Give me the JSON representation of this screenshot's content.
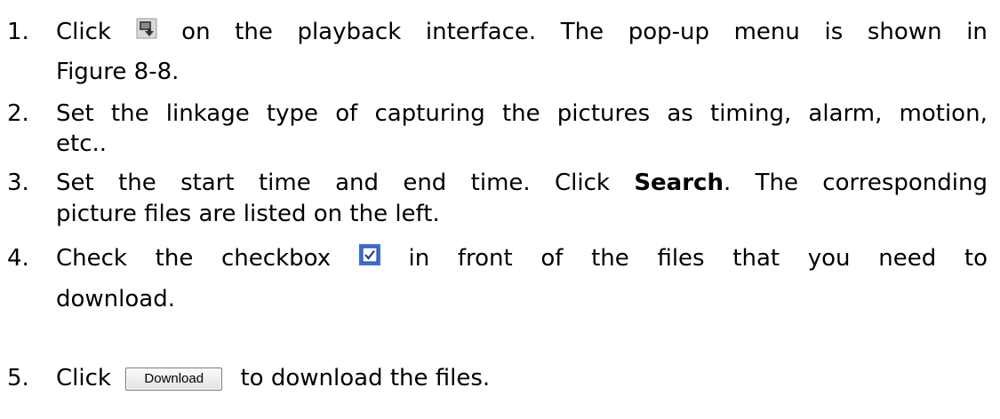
{
  "steps": [
    {
      "number": "1.",
      "before": "Click",
      "icon": "download-picture-icon",
      "after_words": [
        "on",
        "the",
        "playback",
        "interface.",
        "The",
        "pop-up",
        "menu",
        "is",
        "shown",
        "in"
      ],
      "continuation": "Figure 8-8."
    },
    {
      "number": "2.",
      "line1_words": [
        "Set",
        "the",
        "linkage",
        "type",
        "of",
        "capturing",
        "the",
        "pictures",
        "as",
        "timing,",
        "alarm,",
        "motion,"
      ],
      "continuation": "etc.."
    },
    {
      "number": "3.",
      "line1_pre_words": [
        "Set",
        "the",
        "start",
        "time",
        "and",
        "end",
        "time.",
        "Click"
      ],
      "bold": "Search",
      "line1_post_words": [
        ".",
        "The",
        "corresponding"
      ],
      "continuation": "picture files are listed on the left."
    },
    {
      "number": "4.",
      "line1_pre_words": [
        "Check",
        "the",
        "checkbox"
      ],
      "icon": "checkbox-checked-icon",
      "line1_post_words": [
        "in",
        "front",
        "of",
        "the",
        "files",
        "that",
        "you",
        "need",
        "to"
      ],
      "continuation": "download."
    },
    {
      "number": "5.",
      "before": "Click",
      "button_label": "Download",
      "after": "to download the files."
    }
  ],
  "colors": {
    "icon_blue": "#3d6fd6",
    "button_border": "#7a7a7a"
  }
}
